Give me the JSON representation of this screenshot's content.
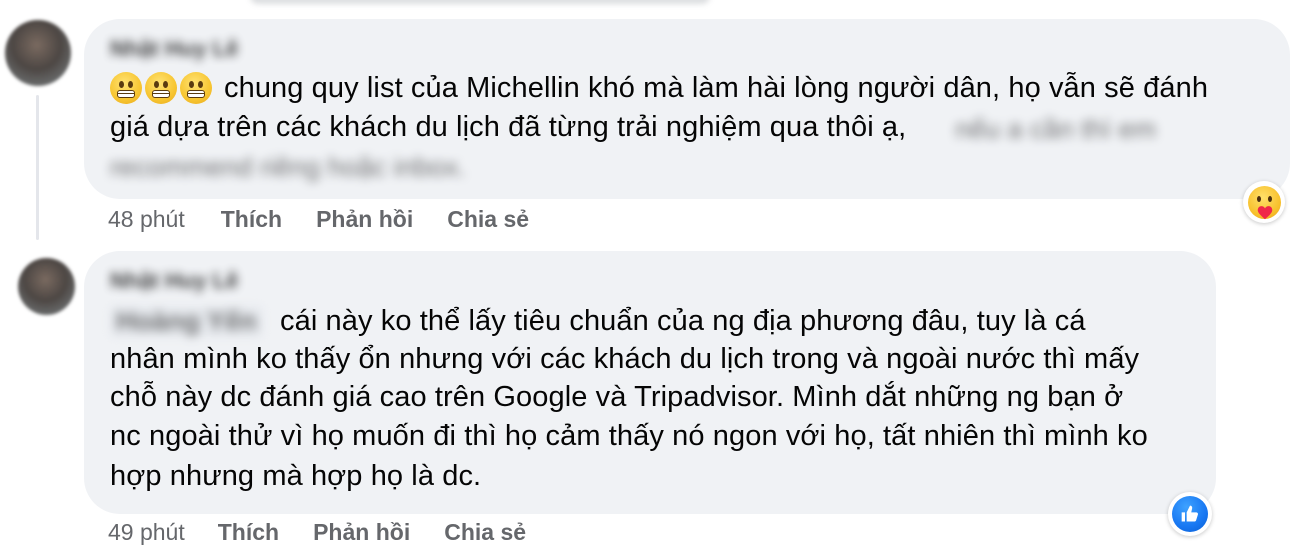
{
  "comments": [
    {
      "author": "Nhật Huy Lê",
      "emojis": [
        "grimacing-face-emoji",
        "grimacing-face-emoji",
        "grimacing-face-emoji"
      ],
      "lines": [
        "chung quy list của Michellin khó mà làm hài lòng người dân, họ vẫn sẽ đánh",
        "giá dựa trên các khách du lịch đã từng trải nghiệm qua thôi ạ,"
      ],
      "blurred_text": [
        "nếu a cần thì em",
        "recommend riêng hoặc inbox."
      ],
      "time": "48 phút",
      "like_label": "Thích",
      "reply_label": "Phản hồi",
      "share_label": "Chia sẻ",
      "reaction_icon": "care-reaction-icon"
    },
    {
      "author": "Nhật Huy Lê",
      "mention": "Hoàng Yến",
      "lines": [
        "cái này ko thể lấy tiêu chuẩn của ng địa phương đâu, tuy là cá",
        "nhân mình ko thấy ổn nhưng với các khách du lịch trong và ngoài nước thì mấy",
        "chỗ này dc đánh giá cao trên Google và Tripadvisor. Mình dắt những ng bạn ở",
        "nc ngoài thử vì họ muốn đi thì họ cảm thấy nó ngon với họ, tất nhiên thì mình ko",
        "hợp nhưng mà hợp họ là dc."
      ],
      "time": "49 phút",
      "like_label": "Thích",
      "reply_label": "Phản hồi",
      "share_label": "Chia sẻ",
      "reaction_icon": "like-reaction-icon"
    }
  ],
  "colors": {
    "bubble": "#f0f2f5",
    "text": "#050505",
    "meta": "#65676b",
    "like_blue": "#1877f2"
  }
}
